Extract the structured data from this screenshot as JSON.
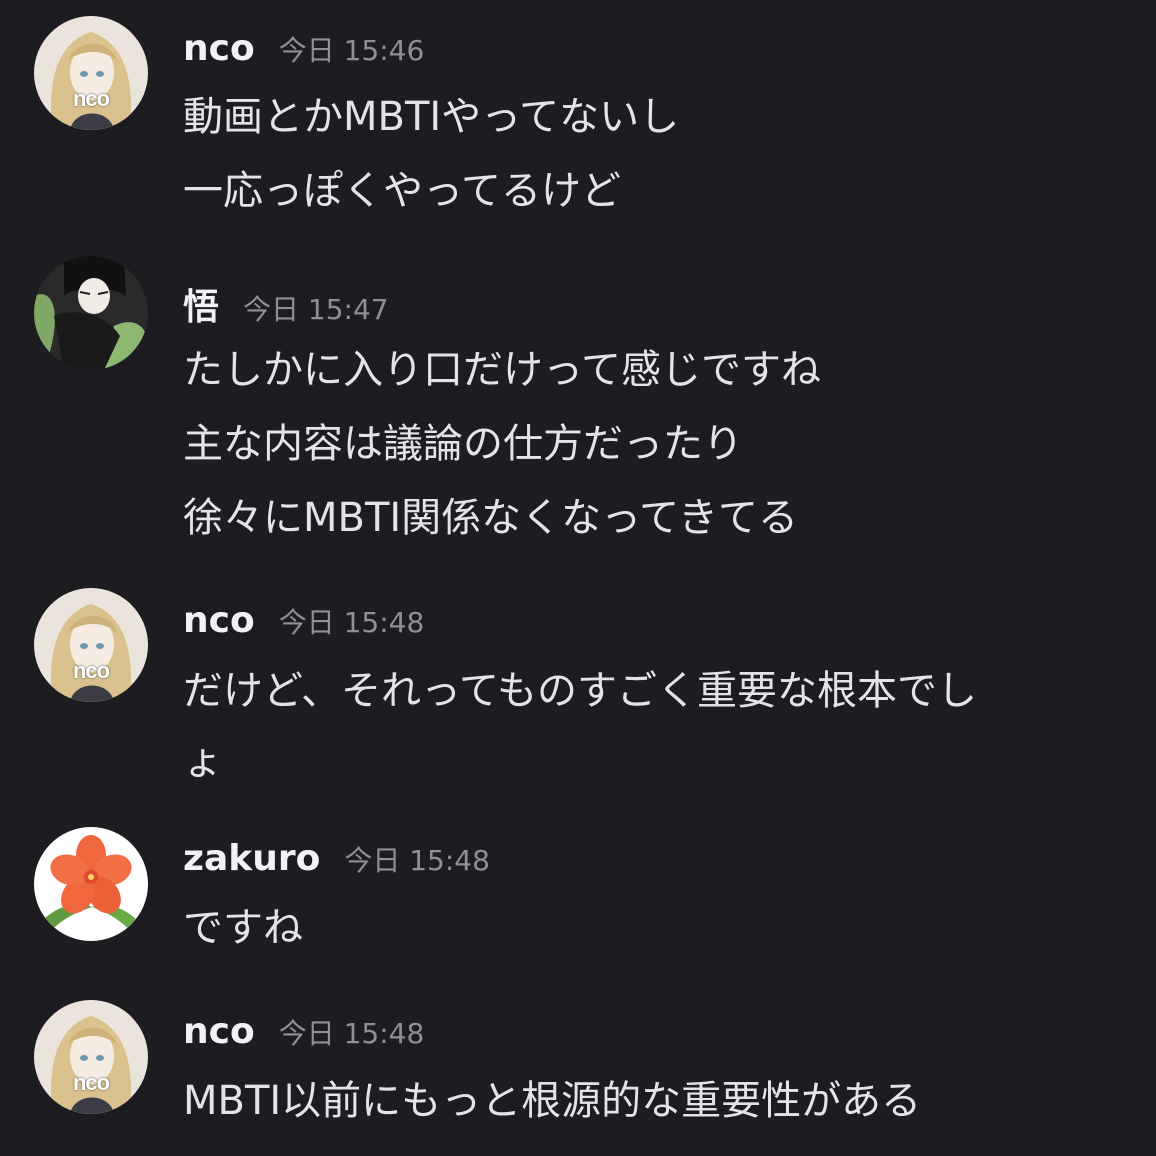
{
  "messages": [
    {
      "username": "nco",
      "timestamp": "今日 15:46",
      "avatar_label": "nco",
      "lines": [
        "動画とかMBTIやってないし",
        "一応っぽくやってるけど"
      ]
    },
    {
      "username": "悟",
      "timestamp": "今日 15:47",
      "lines": [
        "たしかに入り口だけって感じですね",
        "主な内容は議論の仕方だったり",
        "徐々にMBTI関係なくなってきてる"
      ]
    },
    {
      "username": "nco",
      "timestamp": "今日 15:48",
      "avatar_label": "nco",
      "lines": [
        "だけど、それってものすごく重要な根本でし",
        "ょ"
      ]
    },
    {
      "username": "zakuro",
      "timestamp": "今日 15:48",
      "lines": [
        "ですね"
      ]
    },
    {
      "username": "nco",
      "timestamp": "今日 15:48",
      "avatar_label": "nco",
      "lines": [
        "MBTI以前にもっと根源的な重要性がある"
      ]
    }
  ],
  "colors": {
    "background": "#1c1c21",
    "username": "#f2f2f4",
    "timestamp": "#8e9097",
    "text": "#e4e4e7"
  },
  "icons": {
    "nco_avatar": "anime-girl-avatar",
    "satoru_avatar": "sleeping-figure-avatar",
    "zakuro_avatar": "orange-flower-avatar"
  }
}
